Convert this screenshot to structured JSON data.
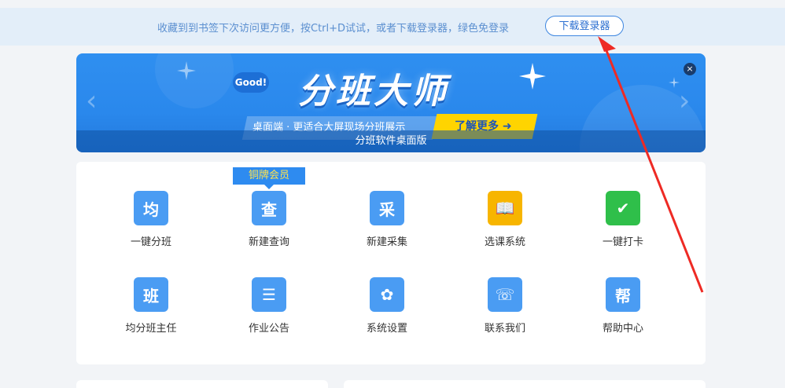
{
  "topbar": {
    "tip": "收藏到到书签下次访问更方便，按Ctrl+D试试，或者下载登录器，绿色免登录",
    "download_button": "下载登录器"
  },
  "banner": {
    "good": "Good!",
    "title": "分班大师",
    "tagline": "桌面端 · 更适合大屏现场分班展示",
    "learn_more": "了解更多 ➜",
    "caption": "分班软件桌面版",
    "close": "×",
    "prev": "‹",
    "next": "›"
  },
  "member_badge": "铜牌会员",
  "features": [
    {
      "label": "一键分班",
      "glyph": "均",
      "icon": "average-icon",
      "color": "#4a9cf3"
    },
    {
      "label": "新建查询",
      "glyph": "查",
      "icon": "query-icon",
      "color": "#4a9cf3"
    },
    {
      "label": "新建采集",
      "glyph": "采",
      "icon": "collect-icon",
      "color": "#4a9cf3"
    },
    {
      "label": "选课系统",
      "glyph": "📖",
      "icon": "book-icon",
      "color": "#f7b500"
    },
    {
      "label": "一键打卡",
      "glyph": "✔",
      "icon": "calendar-check-icon",
      "color": "#2fbf4a"
    },
    {
      "label": "均分班主任",
      "glyph": "班",
      "icon": "class-icon",
      "color": "#4a9cf3"
    },
    {
      "label": "作业公告",
      "glyph": "☰",
      "icon": "document-icon",
      "color": "#4a9cf3"
    },
    {
      "label": "系统设置",
      "glyph": "✿",
      "icon": "gear-icon",
      "color": "#4a9cf3"
    },
    {
      "label": "联系我们",
      "glyph": "☏",
      "icon": "headset-icon",
      "color": "#4a9cf3"
    },
    {
      "label": "帮助中心",
      "glyph": "帮",
      "icon": "help-icon",
      "color": "#4a9cf3"
    }
  ]
}
